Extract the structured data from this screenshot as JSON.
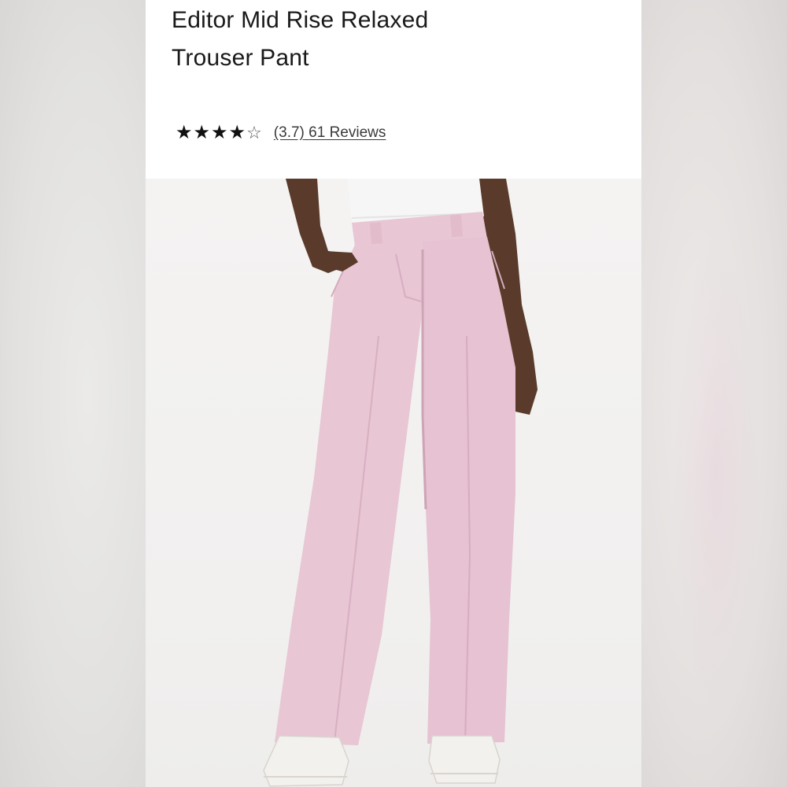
{
  "product": {
    "title_line1": "Editor Mid Rise Relaxed",
    "title_line2": "Trouser Pant",
    "rating_value": 3.7,
    "rating_text": "(3.7)",
    "review_count_text": "61 Reviews",
    "stars": [
      "filled",
      "filled",
      "filled",
      "filled",
      "empty"
    ],
    "star_filled_char": "★",
    "star_empty_char": "☆"
  },
  "image": {
    "subject": "model-wearing-pink-trousers",
    "trouser_color": "#e8c6d4",
    "top_color": "#f6f6f6",
    "sneaker_color": "#f3f1ee",
    "skin_color": "#5a3a2a"
  }
}
